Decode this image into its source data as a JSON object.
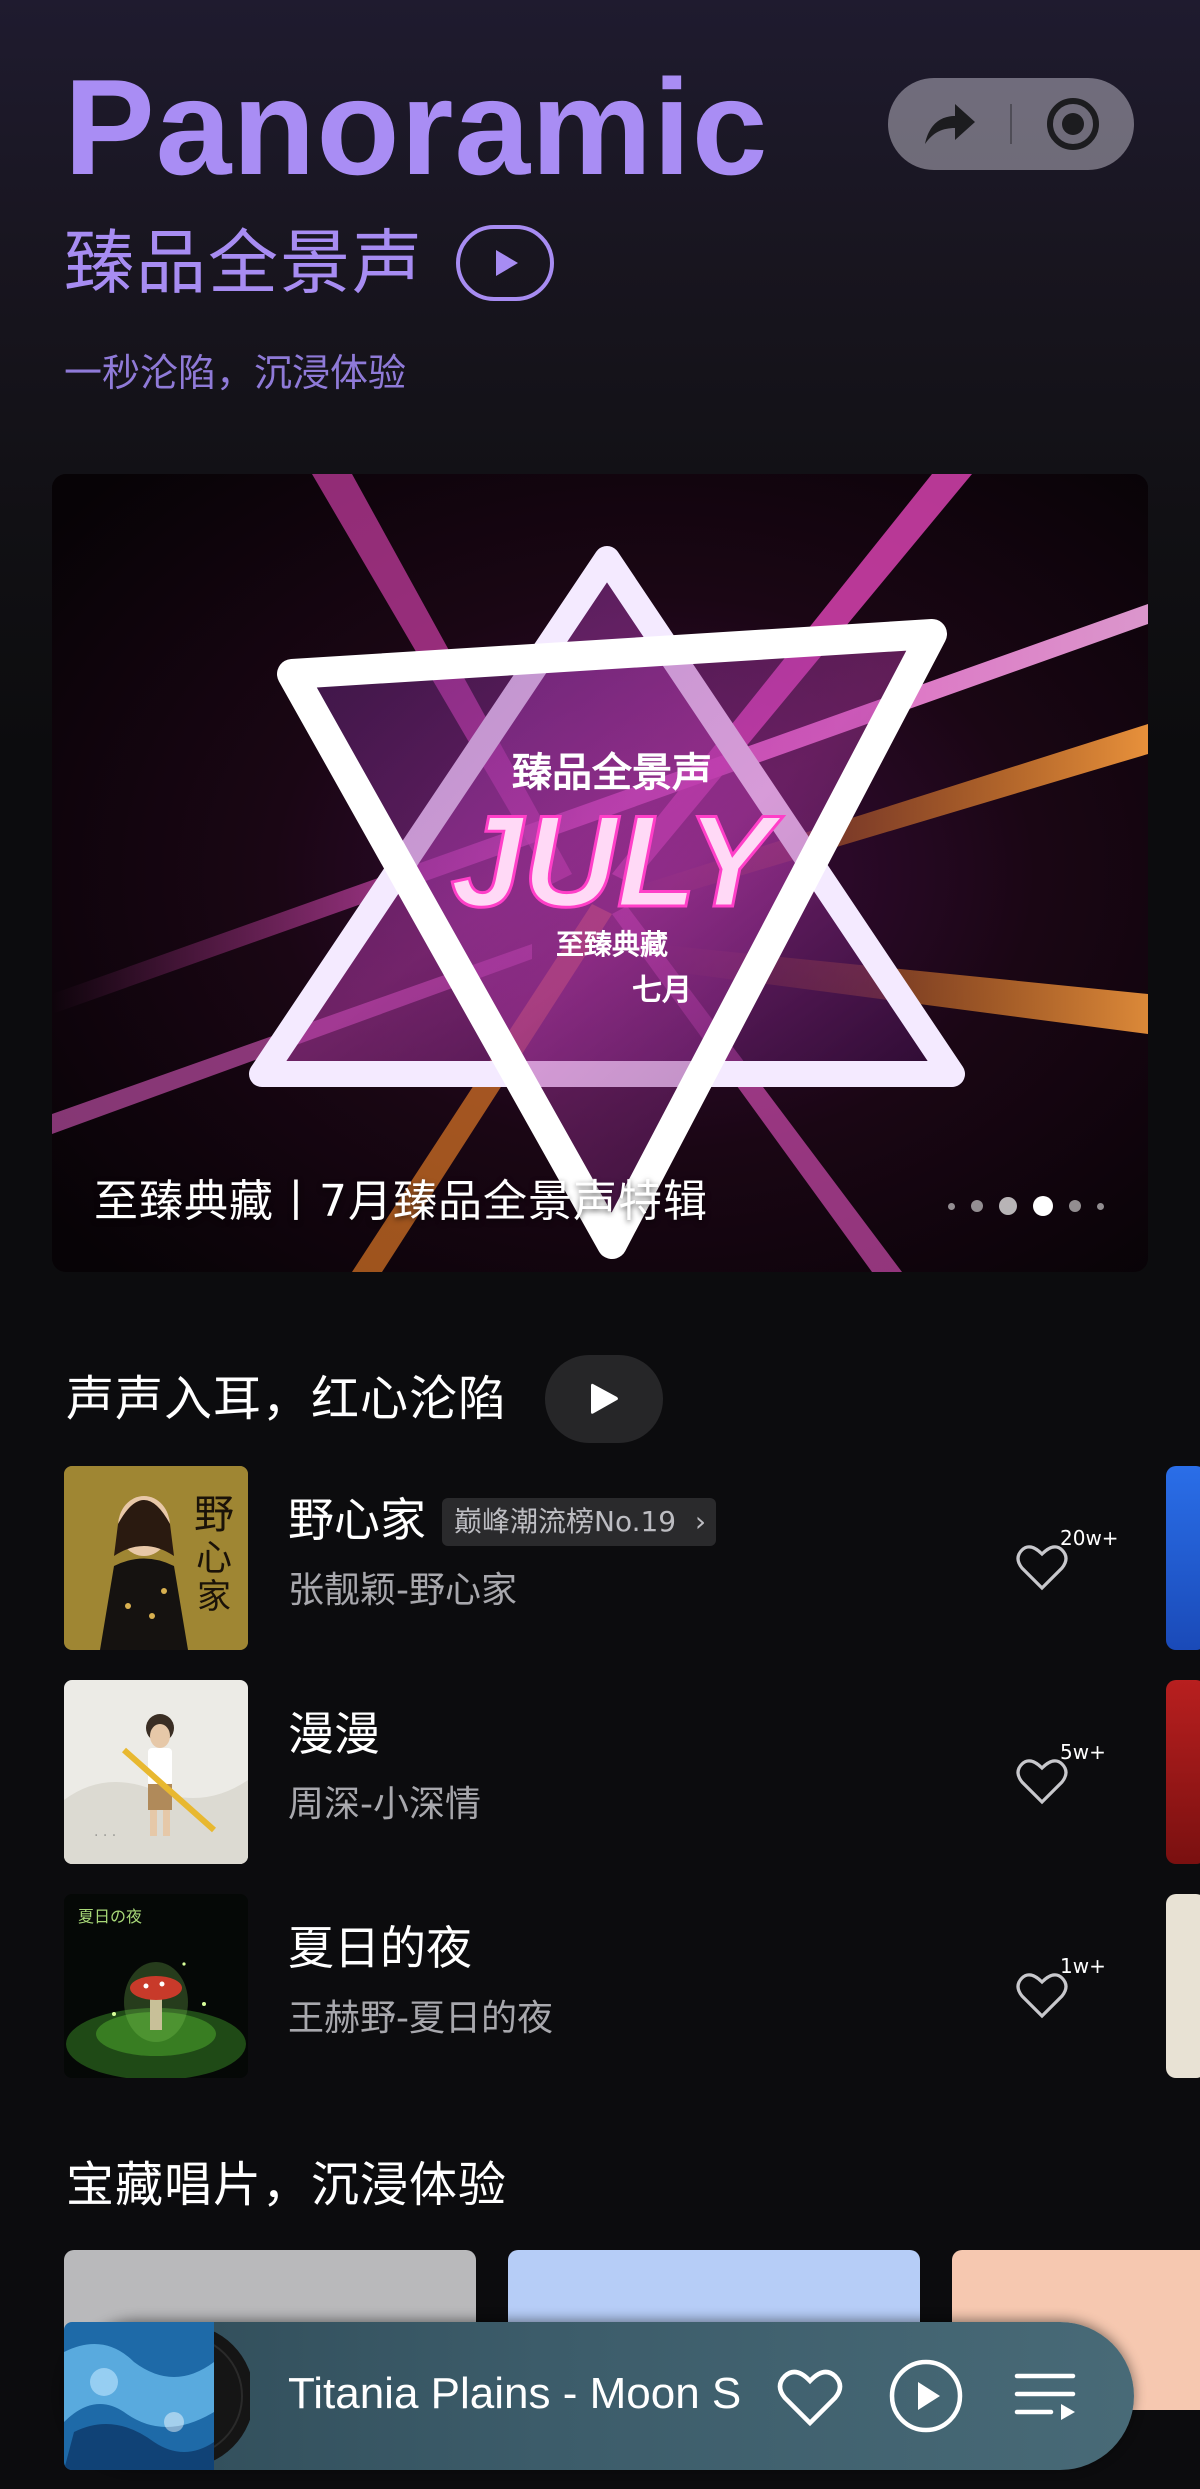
{
  "header": {
    "brand": "Panoramic",
    "subtitle": "臻品全景声",
    "tagline": "一秒沦陷，沉浸体验"
  },
  "banner": {
    "caption": "至臻典藏丨7月臻品全景声特辑",
    "art_text": {
      "top": "臻品全景声",
      "big": "JULY",
      "mid": "至臻典藏",
      "month": "七月"
    },
    "page_count": 6,
    "active_page": 4
  },
  "section_songs": {
    "title": "声声入耳，红心沦陷",
    "songs": [
      {
        "title": "野心家",
        "subtitle": "张靓颖-野心家",
        "chart_tag": "巅峰潮流榜No.19",
        "likes": "20w+"
      },
      {
        "title": "漫漫",
        "subtitle": "周深-小深情",
        "likes": "5w+"
      },
      {
        "title": "夏日的夜",
        "subtitle": "王赫野-夏日的夜",
        "likes": "1w+"
      }
    ]
  },
  "section_albums": {
    "title": "宝藏唱片，沉浸体验"
  },
  "player": {
    "now_playing": "Titania Plains - Moon S"
  },
  "icons": {
    "share": "share-arrow-icon",
    "record": "target-icon",
    "play": "play-icon",
    "heart": "heart-icon",
    "playlist": "playlist-icon"
  },
  "colors": {
    "accent": "#a98df4",
    "background": "#0c0c0e"
  }
}
